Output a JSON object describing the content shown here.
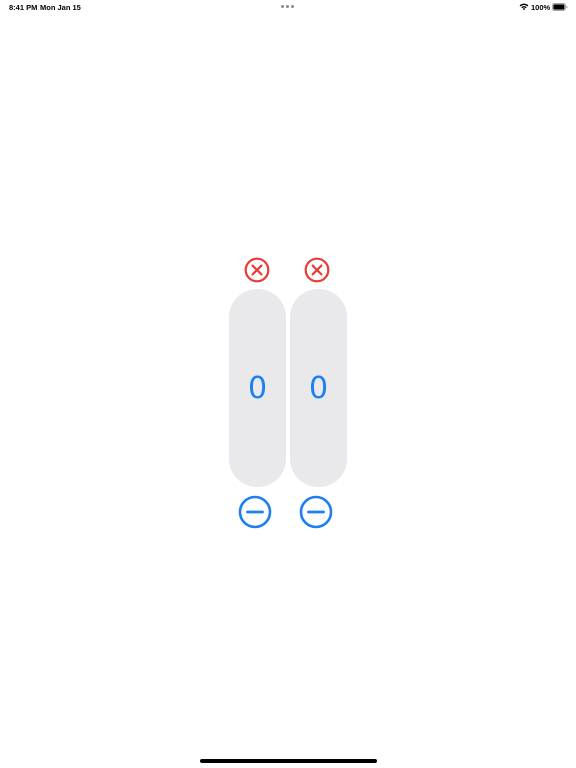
{
  "status_bar": {
    "time": "8:41 PM",
    "date": "Mon Jan 15",
    "battery": "100%"
  },
  "counters": [
    {
      "value": "0"
    },
    {
      "value": "0"
    }
  ],
  "colors": {
    "accent": "#1d7ff0",
    "destructive": "#ea3a33",
    "pill_background": "#e9e9eb"
  },
  "icons": {
    "clear": "xmark-circle-icon",
    "decrement": "minus-circle-icon"
  }
}
